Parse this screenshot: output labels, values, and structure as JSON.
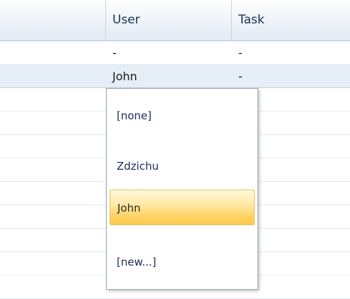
{
  "grid": {
    "columns": [
      "",
      "User",
      "Task"
    ],
    "rows": [
      {
        "c0": "",
        "user": "-",
        "task": "-",
        "selected": false
      },
      {
        "c0": "",
        "user": "John",
        "task": "-",
        "selected": true
      },
      {
        "c0": "",
        "user": "",
        "task": "",
        "selected": false
      },
      {
        "c0": "",
        "user": "",
        "task": "",
        "selected": false
      },
      {
        "c0": "",
        "user": "",
        "task": "",
        "selected": false
      },
      {
        "c0": "",
        "user": "",
        "task": "",
        "selected": false
      },
      {
        "c0": "",
        "user": "",
        "task": "",
        "selected": false
      },
      {
        "c0": "",
        "user": "",
        "task": "",
        "selected": false
      },
      {
        "c0": "",
        "user": "",
        "task": "",
        "selected": false
      },
      {
        "c0": "",
        "user": "",
        "task": "",
        "selected": false
      },
      {
        "c0": "",
        "user": "-",
        "task": "-",
        "selected": false
      }
    ]
  },
  "dropdown": {
    "options": [
      {
        "label": "[none]",
        "active": false
      },
      {
        "label": "Zdzichu",
        "active": false
      },
      {
        "label": "John",
        "active": true
      },
      {
        "label": "[new...]",
        "active": false
      }
    ],
    "highlight_color": "#ffd770"
  }
}
